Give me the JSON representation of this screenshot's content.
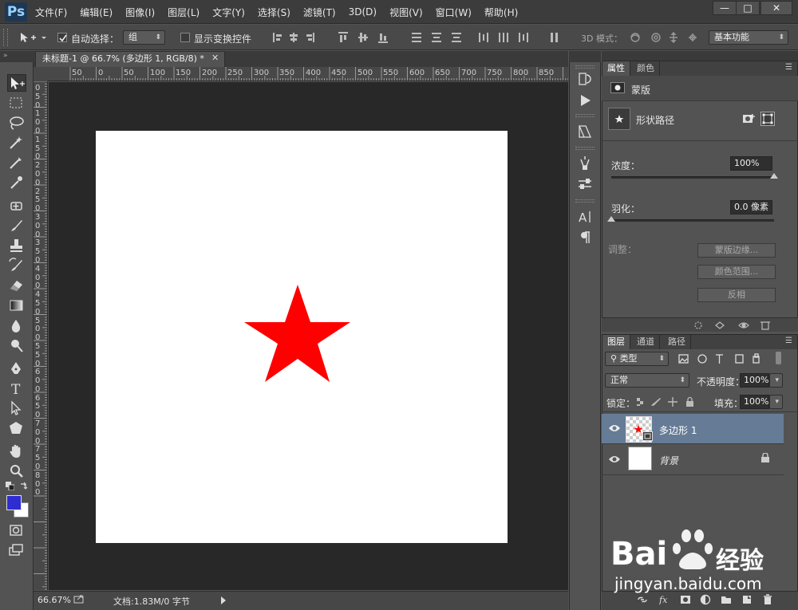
{
  "app": {
    "logo": "Ps"
  },
  "menu": [
    "文件(F)",
    "编辑(E)",
    "图像(I)",
    "图层(L)",
    "文字(Y)",
    "选择(S)",
    "滤镜(T)",
    "3D(D)",
    "视图(V)",
    "窗口(W)",
    "帮助(H)"
  ],
  "window_controls": {
    "minimize": "—",
    "maximize": "□",
    "close": "✕"
  },
  "options": {
    "auto_select_label": "自动选择：",
    "auto_select_checked": true,
    "auto_select_value": "组",
    "show_transform_label": "显示变换控件",
    "mode_3d_label": "3D 模式：",
    "workspace": "基本功能"
  },
  "doc_tab": {
    "title": "未标题-1 @ 66.7% (多边形 1, RGB/8) *",
    "close": "✕"
  },
  "ruler": {
    "top": [
      "50",
      "0",
      "50",
      "100",
      "150",
      "200",
      "250",
      "300",
      "350",
      "400",
      "450",
      "500",
      "550",
      "600",
      "650",
      "700",
      "750",
      "800",
      "850"
    ],
    "left": [
      "0",
      "5",
      "0",
      "1",
      "0",
      "0",
      "1",
      "5",
      "0",
      "2",
      "0",
      "0",
      "2",
      "5",
      "0",
      "3",
      "0",
      "0",
      "3",
      "5",
      "0",
      "4",
      "0",
      "0",
      "4",
      "5",
      "0",
      "5",
      "0",
      "0",
      "5",
      "5",
      "0",
      "6",
      "0",
      "0",
      "6",
      "5",
      "0",
      "7",
      "0",
      "0",
      "7",
      "5",
      "0",
      "8",
      "0",
      "0"
    ]
  },
  "colors": {
    "foreground": "#2d2dd2",
    "background": "#ffffff",
    "star": "#ff0000",
    "canvas": "#ffffff",
    "pasteboard": "#282828"
  },
  "status": {
    "zoom": "66.67%",
    "doc_info": "文档:1.83M/0 字节"
  },
  "properties": {
    "tabs": [
      "属性",
      "颜色"
    ],
    "mask_label": "蒙版",
    "shape_path_label": "形状路径",
    "density_label": "浓度：",
    "density_value": "100%",
    "density_fraction": 1.0,
    "feather_label": "羽化：",
    "feather_value": "0.0 像素",
    "feather_fraction": 0.0,
    "adjust_label": "调整：",
    "buttons": [
      "蒙版边缘...",
      "颜色范围...",
      "反相"
    ]
  },
  "layers": {
    "tabs": [
      "图层",
      "通道",
      "路径"
    ],
    "filter_label": "类型",
    "blend_mode": "正常",
    "opacity_label": "不透明度：",
    "opacity_value": "100%",
    "lock_label": "锁定：",
    "fill_label": "填充：",
    "fill_value": "100%",
    "items": [
      {
        "name": "多边形 1",
        "selected": true
      },
      {
        "name": "背景",
        "locked": true
      }
    ]
  },
  "watermark": {
    "brand": "Bai",
    "brand2": "经验",
    "url": "jingyan.baidu.com"
  }
}
